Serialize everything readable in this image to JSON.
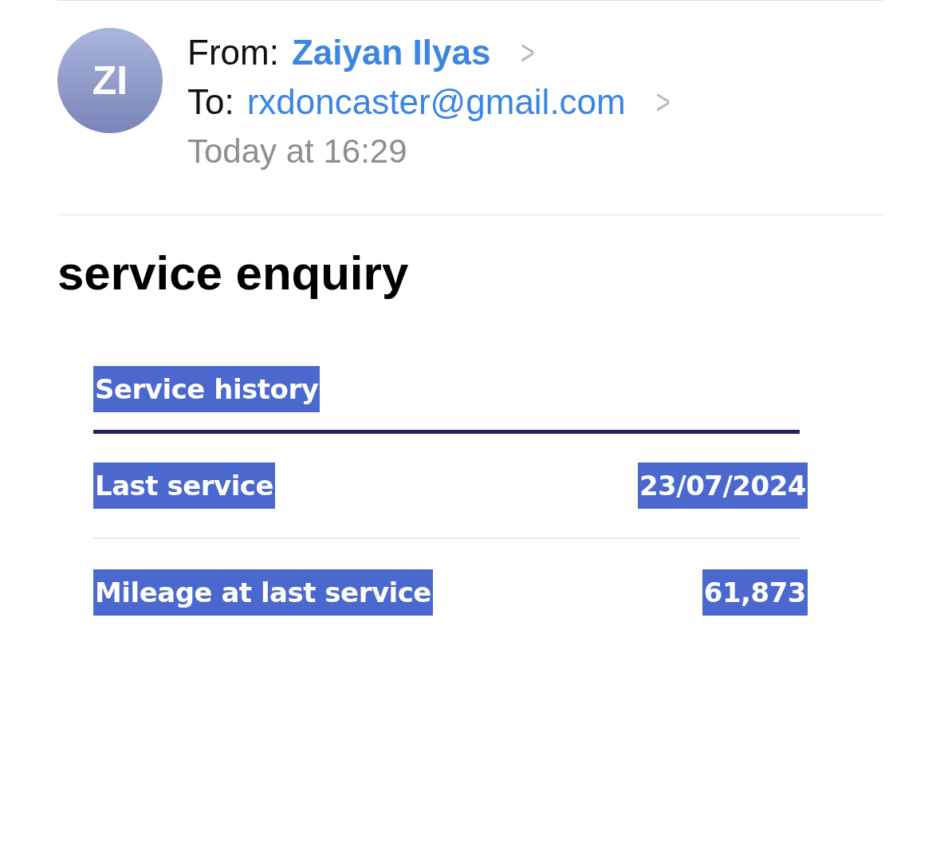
{
  "header": {
    "from_label": "From:",
    "from_name": "Zaiyan Ilyas",
    "to_label": "To:",
    "to_address": "rxdoncaster@gmail.com",
    "time": "Today at 16:29",
    "avatar_initials": "ZI",
    "chevron": ">"
  },
  "subject": "service enquiry",
  "service_card": {
    "title": {
      "text": "Service history",
      "highlighted": true
    },
    "rows": [
      {
        "label": {
          "text": "Last service",
          "highlighted": true
        },
        "value": {
          "text": "23/07/2024",
          "highlighted": true
        }
      },
      {
        "label": {
          "text": "Mileage at last service",
          "highlighted": true
        },
        "value": {
          "text": "61,873",
          "highlighted": true
        }
      }
    ]
  }
}
